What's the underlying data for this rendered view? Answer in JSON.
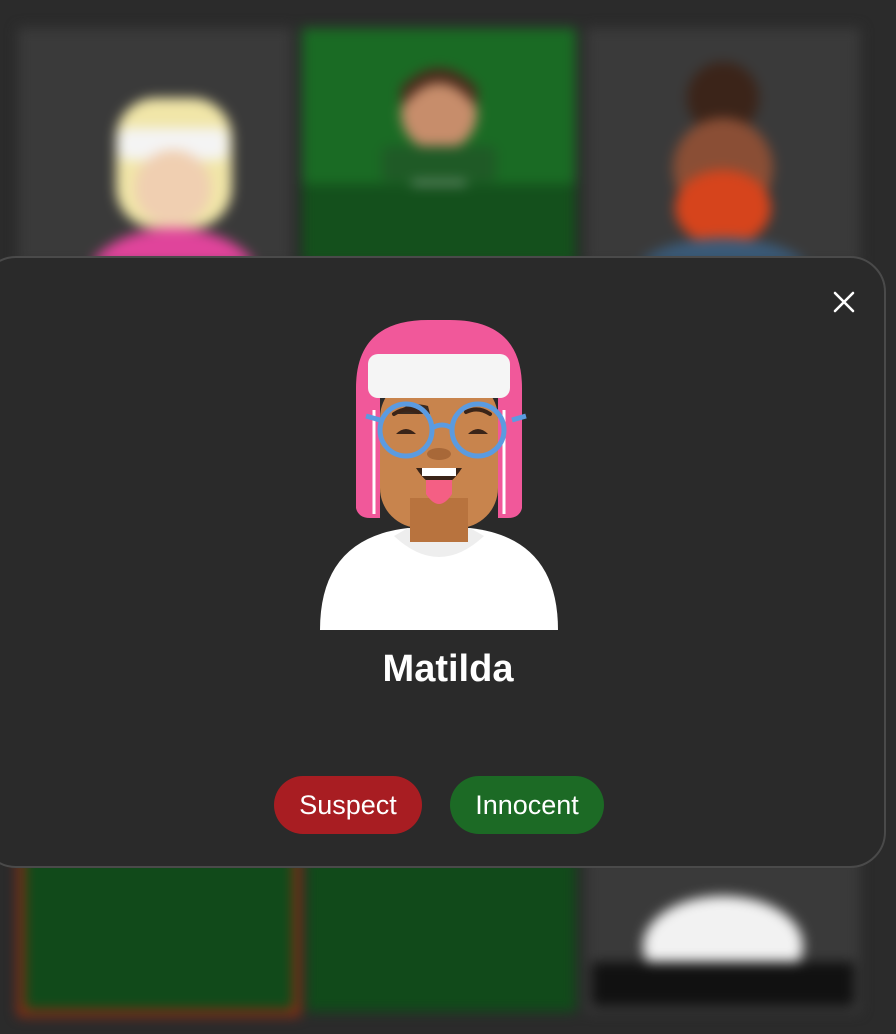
{
  "colors": {
    "suspect": "#a81d22",
    "innocent": "#1c6a25",
    "modal_background": "#2a2a2a"
  },
  "modal": {
    "player_name": "Matilda",
    "close_icon": "close-icon",
    "buttons": {
      "suspect": "Suspect",
      "innocent": "Innocent"
    }
  }
}
